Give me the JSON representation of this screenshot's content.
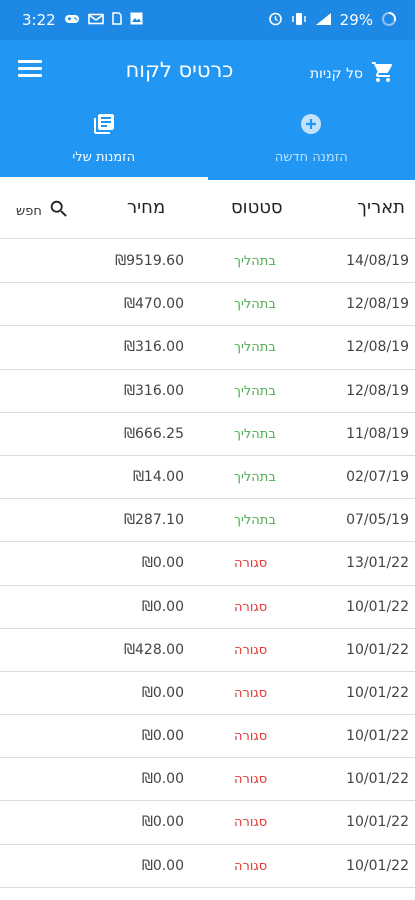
{
  "status_bar": {
    "time": "3:22",
    "battery": "29%"
  },
  "app_bar": {
    "title": "כרטיס לקוח",
    "cart_label": "סל קניות"
  },
  "tabs": [
    {
      "label": "הזמנה חדשה",
      "icon": "add-circle-icon",
      "active": false
    },
    {
      "label": "הזמנות שלי",
      "icon": "orders-list-icon",
      "active": true
    }
  ],
  "table": {
    "headers": {
      "date": "תאריך",
      "status": "סטטוס",
      "price": "מחיר",
      "search": "חפש"
    },
    "status_colors": {
      "בתהליך": "#4caf50",
      "סגורה": "#e53935"
    },
    "rows": [
      {
        "date": "14/08/19",
        "status": "בתהליך",
        "price": "₪9519.60"
      },
      {
        "date": "12/08/19",
        "status": "בתהליך",
        "price": "₪470.00"
      },
      {
        "date": "12/08/19",
        "status": "בתהליך",
        "price": "₪316.00"
      },
      {
        "date": "12/08/19",
        "status": "בתהליך",
        "price": "₪316.00"
      },
      {
        "date": "11/08/19",
        "status": "בתהליך",
        "price": "₪666.25"
      },
      {
        "date": "02/07/19",
        "status": "בתהליך",
        "price": "₪14.00"
      },
      {
        "date": "07/05/19",
        "status": "בתהליך",
        "price": "₪287.10"
      },
      {
        "date": "13/01/22",
        "status": "סגורה",
        "price": "₪0.00"
      },
      {
        "date": "10/01/22",
        "status": "סגורה",
        "price": "₪0.00"
      },
      {
        "date": "10/01/22",
        "status": "סגורה",
        "price": "₪428.00"
      },
      {
        "date": "10/01/22",
        "status": "סגורה",
        "price": "₪0.00"
      },
      {
        "date": "10/01/22",
        "status": "סגורה",
        "price": "₪0.00"
      },
      {
        "date": "10/01/22",
        "status": "סגורה",
        "price": "₪0.00"
      },
      {
        "date": "10/01/22",
        "status": "סגורה",
        "price": "₪0.00"
      },
      {
        "date": "10/01/22",
        "status": "סגורה",
        "price": "₪0.00"
      }
    ]
  }
}
